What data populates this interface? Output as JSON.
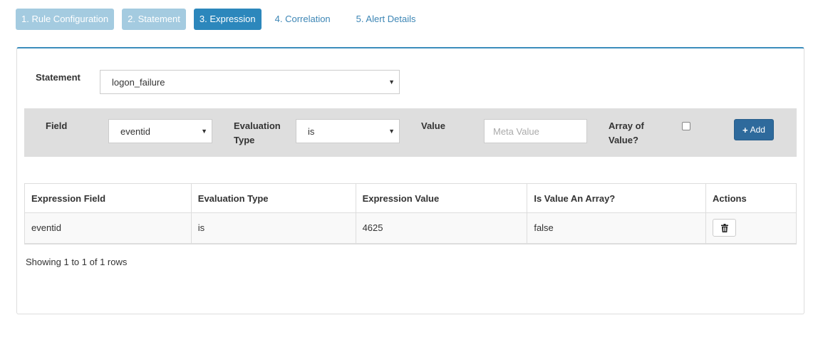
{
  "steps": [
    {
      "label": "1. Rule Configuration",
      "state": "done"
    },
    {
      "label": "2. Statement",
      "state": "done"
    },
    {
      "label": "3. Expression",
      "state": "active"
    },
    {
      "label": "4. Correlation",
      "state": "todo"
    },
    {
      "label": "5. Alert Details",
      "state": "todo"
    }
  ],
  "statement": {
    "label": "Statement",
    "selected": "logon_failure"
  },
  "criteria": {
    "field_label": "Field",
    "field_selected": "eventid",
    "eval_label": "Evaluation Type",
    "eval_selected": "is",
    "value_label": "Value",
    "value_placeholder": "Meta Value",
    "value_current": "",
    "array_label": "Array of Value?",
    "array_checked": false,
    "add_label": "Add",
    "add_icon": "plus-icon"
  },
  "table": {
    "headers": [
      "Expression Field",
      "Evaluation Type",
      "Expression Value",
      "Is Value An Array?",
      "Actions"
    ],
    "rows": [
      {
        "field": "eventid",
        "eval_type": "is",
        "value": "4625",
        "is_array": "false",
        "action_icon": "trash-icon"
      }
    ]
  },
  "footer": {
    "info": "Showing 1 to 1 of 1 rows"
  },
  "colors": {
    "active_step": "#2c87bc",
    "done_step": "#a4cbe0",
    "link": "#3d86b5",
    "panel_accent": "#3c8dbc",
    "add_button": "#2e6a9c",
    "criteria_bg": "#dedede"
  }
}
